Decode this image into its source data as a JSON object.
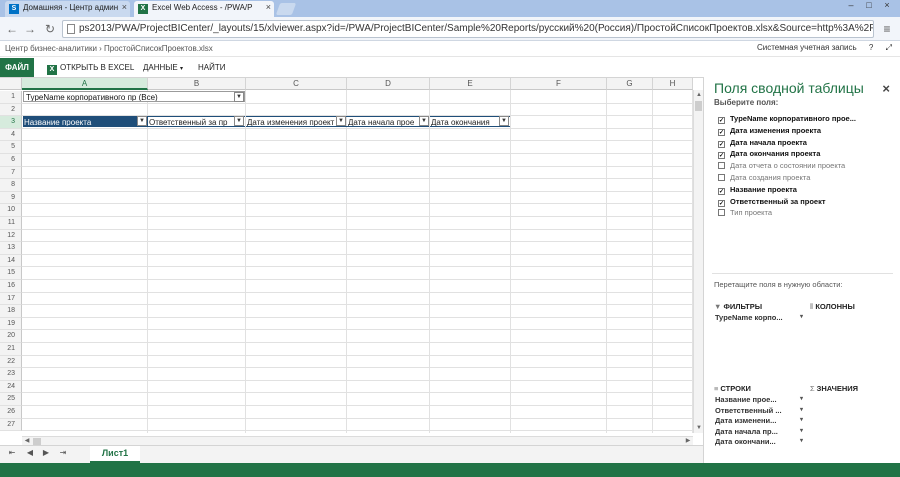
{
  "browser": {
    "tabs": [
      {
        "title": "Домашняя - Центр админ",
        "icon": "sharepoint-icon",
        "active": false
      },
      {
        "title": "Excel Web Access - /PWA/P",
        "icon": "excel-icon",
        "active": true
      }
    ],
    "close_glyph": "×",
    "url": "ps2013/PWA/ProjectBICenter/_layouts/15/xlviewer.aspx?id=/PWA/ProjectBICenter/Sample%20Reports/русский%20(Россия)/ПростойСписокПроектов.xlsx&Source=http%3A%2F%2Fps20",
    "window_buttons": [
      "–",
      "□",
      "×"
    ]
  },
  "sharepoint": {
    "breadcrumb": "Центр бизнес-аналитики  ›  ПростойСписокПроектов.xlsx",
    "account": "Системная учетная запись",
    "help": "?",
    "fullscreen": "⤢"
  },
  "ribbon": {
    "file": "ФАЙЛ",
    "open_excel": "ОТКРЫТЬ В EXCEL",
    "data": "ДАННЫЕ",
    "find": "НАЙТИ"
  },
  "grid": {
    "columns": [
      "A",
      "B",
      "C",
      "D",
      "E",
      "F",
      "G",
      "H"
    ],
    "selected_column": "A",
    "rows": [
      "1",
      "2",
      "3",
      "4",
      "5",
      "6",
      "7",
      "8",
      "9",
      "10",
      "11",
      "12",
      "13",
      "14",
      "15",
      "16",
      "17",
      "18",
      "19",
      "20",
      "21",
      "22",
      "23",
      "24",
      "25",
      "26",
      "27"
    ],
    "selected_row": "3",
    "filter_label": "TypeName корпоративного пр",
    "filter_value": "(Все)",
    "headers": [
      "Название проекта",
      "Ответственный за пр",
      "Дата изменения проект",
      "Дата начала прое",
      "Дата окончания"
    ]
  },
  "sheets": {
    "nav": [
      "⇤",
      "◀",
      "▶",
      "⇥"
    ],
    "active": "Лист1"
  },
  "pivot_pane": {
    "title": "Поля сводной таблицы",
    "subtitle": "Выберите поля:",
    "fields": [
      {
        "label": "TypeName корпоративного прое...",
        "checked": true
      },
      {
        "label": "Дата изменения проекта",
        "checked": true
      },
      {
        "label": "Дата начала проекта",
        "checked": true
      },
      {
        "label": "Дата окончания проекта",
        "checked": true
      },
      {
        "label": "Дата отчета о состоянии проекта",
        "checked": false
      },
      {
        "label": "Дата создания проекта",
        "checked": false
      },
      {
        "label": "Название проекта",
        "checked": true
      },
      {
        "label": "Ответственный за проект",
        "checked": true
      },
      {
        "label": "Тип проекта",
        "checked": false
      }
    ],
    "drag_hint": "Перетащите поля в нужную области:",
    "areas": {
      "filters": {
        "title": "ФИЛЬТРЫ",
        "items": [
          "TypeName корпо..."
        ]
      },
      "columns": {
        "title": "КОЛОННЫ",
        "items": []
      },
      "rows": {
        "title": "СТРОКИ",
        "items": [
          "Название прое...",
          "Ответственный ...",
          "Дата изменени...",
          "Дата начала пр...",
          "Дата окончани..."
        ]
      },
      "values": {
        "title": "ЗНАЧЕНИЯ",
        "items": []
      }
    }
  },
  "colors": {
    "excel_green": "#217346",
    "header_blue": "#1f4e79"
  }
}
